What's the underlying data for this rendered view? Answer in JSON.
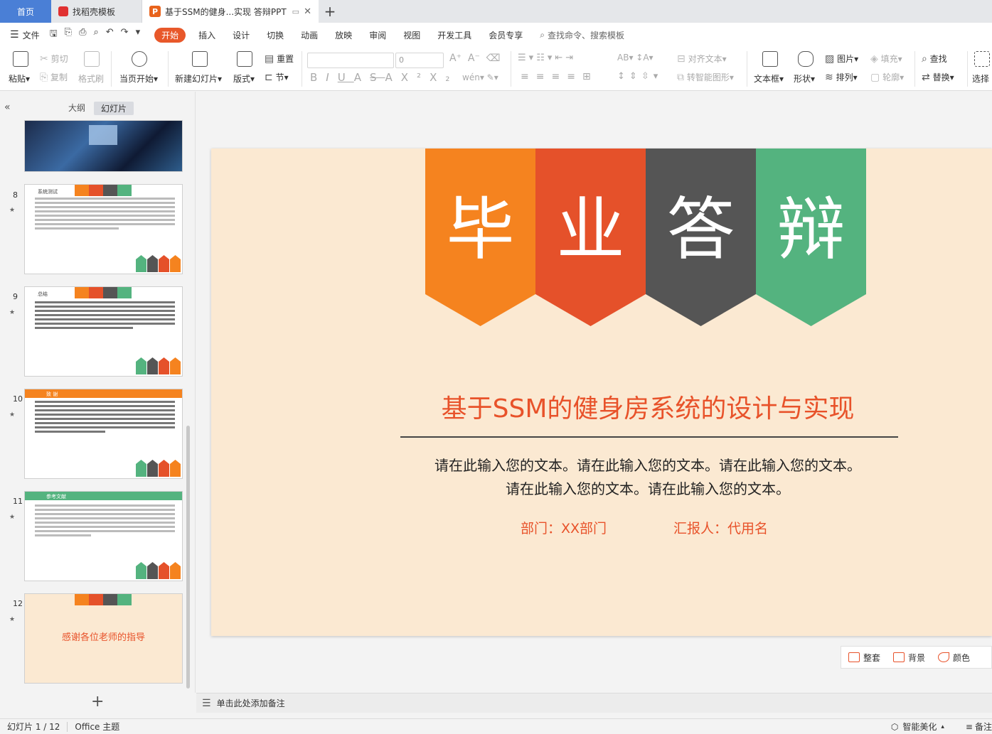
{
  "tabs": {
    "home": "首页",
    "template": "找稻壳模板",
    "doc": "基于SSM的健身...实现 答辩PPT"
  },
  "menu": {
    "file": "文件",
    "items": [
      "开始",
      "插入",
      "设计",
      "切换",
      "动画",
      "放映",
      "审阅",
      "视图",
      "开发工具",
      "会员专享"
    ],
    "search": "查找命令、搜索模板"
  },
  "ribbon": {
    "paste": "粘贴",
    "cut": "剪切",
    "copy": "复制",
    "format_painter": "格式刷",
    "from_current": "当页开始",
    "new_slide": "新建幻灯片",
    "layout": "版式",
    "section": "节",
    "reset": "重置",
    "font_size": "0",
    "align_text": "对齐文本",
    "smart_shape": "转智能图形",
    "textbox": "文本框",
    "shape": "形状",
    "picture": "图片",
    "arrange": "排列",
    "fill": "填充",
    "outline": "轮廓",
    "find": "查找",
    "replace": "替换",
    "select": "选择"
  },
  "left_panel": {
    "tab_outline": "大纲",
    "tab_slides": "幻灯片",
    "slides": [
      {
        "num": "8",
        "title": "系统测试"
      },
      {
        "num": "9",
        "title": "总结"
      },
      {
        "num": "10",
        "title": "致 谢"
      },
      {
        "num": "11",
        "title": "参考文献"
      },
      {
        "num": "12",
        "title": "感谢各位老师的指导"
      }
    ]
  },
  "slide": {
    "banner_chars": [
      "毕",
      "业",
      "答",
      "辩"
    ],
    "banner_colors": [
      "#f5831f",
      "#e5512a",
      "#555555",
      "#54b37f"
    ],
    "title": "基于SSM的健身房系统的设计与实现",
    "body_line1": "请在此输入您的文本。请在此输入您的文本。请在此输入您的文本。",
    "body_line2": "请在此输入您的文本。请在此输入您的文本。",
    "dept": "部门：XX部门",
    "reporter": "汇报人：代用名"
  },
  "floatbar": {
    "tidy": "整套",
    "background": "背景",
    "color": "颜色"
  },
  "notes": {
    "placeholder": "单击此处添加备注"
  },
  "status": {
    "slide_count": "幻灯片 1 / 12",
    "theme": "Office 主题",
    "beautify": "智能美化",
    "notes": "备注"
  }
}
